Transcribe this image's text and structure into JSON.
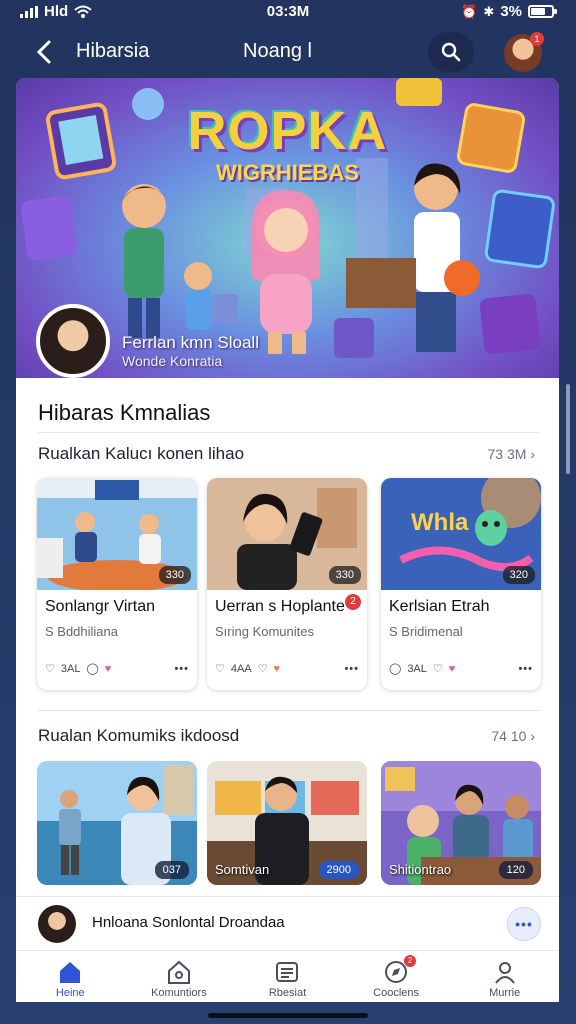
{
  "status_bar": {
    "carrier": "Hld",
    "time": "03:3M",
    "battery_text": "3%"
  },
  "header": {
    "back_icon": "chevron-left-icon",
    "title": "Hibarsia",
    "center_title": "Noang l",
    "avatar_badge": "1"
  },
  "hero": {
    "title": "ROPKA",
    "subtitle": "WIGRHIEBAS",
    "caption_line1": "Ferrlan kmn Sloall",
    "caption_line2": "Wonde Konratia"
  },
  "section": {
    "title": "Hibaras Kmnalias"
  },
  "row1": {
    "title": "Rualkan Kalucı konen lihao",
    "count": "73 3M",
    "cards": [
      {
        "title": "Sonlangr Virtan",
        "subtitle": "S Bddhiliana",
        "badge": "330",
        "likes": "3AL"
      },
      {
        "title": "Uerran s Hoplante",
        "subtitle": "Sıring Komunites",
        "badge": "330",
        "likes": "4AA",
        "new_badge": "2"
      },
      {
        "title": "Kerlsian Etrah",
        "subtitle": "S Bridimenal",
        "badge": "320",
        "likes": "3AL"
      }
    ]
  },
  "row2": {
    "title": "Rualan Komumiks ikdoosd",
    "count": "74 10",
    "cards": [
      {
        "label": "",
        "badge": "037"
      },
      {
        "label": "Somtivan",
        "badge": "2900"
      },
      {
        "label": "Shitiontrao",
        "badge": "120"
      }
    ]
  },
  "mini_player": {
    "text": "Hnloana Sonlontal Droandaa"
  },
  "bottom_nav": [
    {
      "label": "Heine",
      "icon": "home-icon",
      "active": true
    },
    {
      "label": "Komuntiors",
      "icon": "community-icon",
      "active": false
    },
    {
      "label": "Rbesiat",
      "icon": "news-icon",
      "active": false
    },
    {
      "label": "Cooclens",
      "icon": "discover-icon",
      "active": false,
      "badge": "2"
    },
    {
      "label": "Murrie",
      "icon": "profile-icon",
      "active": false
    }
  ],
  "colors": {
    "accent": "#2f55d4",
    "background": "#22345f",
    "badge_red": "#e23b3b"
  }
}
